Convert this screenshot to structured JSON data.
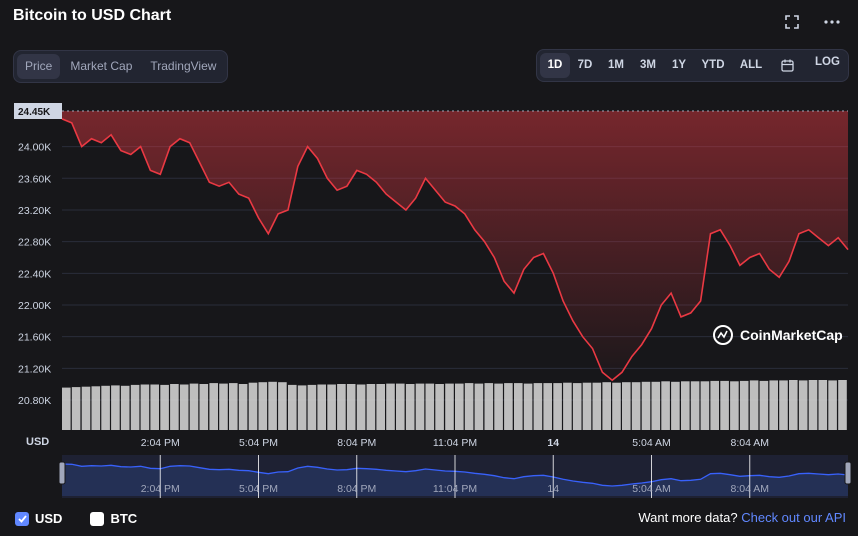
{
  "header": {
    "title": "Bitcoin to USD Chart"
  },
  "tabs": [
    {
      "label": "Price",
      "active": true
    },
    {
      "label": "Market Cap",
      "active": false
    },
    {
      "label": "TradingView",
      "active": false
    }
  ],
  "ranges": [
    {
      "label": "1D",
      "active": true
    },
    {
      "label": "7D",
      "active": false
    },
    {
      "label": "1M",
      "active": false
    },
    {
      "label": "3M",
      "active": false
    },
    {
      "label": "1Y",
      "active": false
    },
    {
      "label": "YTD",
      "active": false
    },
    {
      "label": "ALL",
      "active": false
    }
  ],
  "log_label": "LOG",
  "icons": {
    "expand": "expand-icon",
    "more": "more-icon",
    "calendar": "calendar-icon"
  },
  "colors": {
    "price_line": "#ea3943",
    "volume_bar": "#dcdcdc",
    "navigator_line": "#3861fb",
    "accent_link": "#6188ff"
  },
  "watermark": "CoinMarketCap",
  "legend": [
    {
      "label": "USD",
      "checked": true
    },
    {
      "label": "BTC",
      "checked": false
    }
  ],
  "footer": {
    "text": "Want more data?",
    "link": "Check out our API"
  },
  "chart_data": {
    "type": "line",
    "ylabel": "USD",
    "ylim": [
      20800,
      24450
    ],
    "y_ticks": [
      "24.00K",
      "23.60K",
      "23.20K",
      "22.80K",
      "22.40K",
      "22.00K",
      "21.60K",
      "21.20K",
      "20.80K"
    ],
    "y_tick_values": [
      24000,
      23600,
      23200,
      22800,
      22400,
      22000,
      21600,
      21200,
      20800
    ],
    "current_price_label": "24.45K",
    "current_price_value": 24450,
    "x_ticks": [
      "2:04 PM",
      "5:04 PM",
      "8:04 PM",
      "11:04 PM",
      "14",
      "5:04 AM",
      "8:04 AM"
    ],
    "x_tick_hours": [
      3,
      6,
      9,
      12,
      15,
      18,
      21
    ],
    "xlim_hours": [
      0,
      24
    ],
    "series": [
      {
        "x": [
          0,
          0.3,
          0.6,
          0.9,
          1.2,
          1.5,
          1.8,
          2.1,
          2.4,
          2.7,
          3.0,
          3.3,
          3.6,
          3.9,
          4.2,
          4.5,
          4.8,
          5.1,
          5.4,
          5.7,
          6.0,
          6.3,
          6.6,
          6.9,
          7.2,
          7.5,
          7.8,
          8.1,
          8.4,
          8.7,
          9.0,
          9.3,
          9.6,
          9.9,
          10.2,
          10.5,
          10.8,
          11.1,
          11.4,
          11.7,
          12.0,
          12.3,
          12.6,
          12.9,
          13.2,
          13.5,
          13.8,
          14.1,
          14.4,
          14.7,
          15.0,
          15.3,
          15.6,
          15.9,
          16.2,
          16.5,
          16.8,
          17.1,
          17.4,
          17.7,
          18.0,
          18.3,
          18.6,
          18.9,
          19.2,
          19.5,
          19.8,
          20.1,
          20.4,
          20.7,
          21.0,
          21.3,
          21.6,
          21.9,
          22.2,
          22.5,
          22.8,
          23.1,
          23.4,
          23.7,
          24.0
        ],
        "values": [
          24350,
          24300,
          24000,
          24100,
          24050,
          24150,
          23950,
          23900,
          24000,
          23700,
          23650,
          24000,
          24100,
          24050,
          23800,
          23550,
          23500,
          23550,
          23400,
          23350,
          23100,
          22900,
          23150,
          23200,
          23750,
          24000,
          23850,
          23600,
          23450,
          23500,
          23700,
          23650,
          23550,
          23400,
          23300,
          23200,
          23350,
          23600,
          23450,
          23300,
          23250,
          23150,
          22950,
          22800,
          22600,
          22300,
          22150,
          22450,
          22600,
          22650,
          22400,
          22050,
          21800,
          21600,
          21450,
          21150,
          21050,
          21150,
          21350,
          21500,
          21700,
          22000,
          22150,
          21850,
          21900,
          22050,
          22900,
          22950,
          22750,
          22500,
          22600,
          22650,
          22450,
          22350,
          22550,
          22900,
          22950,
          22850,
          22750,
          22850,
          22700
        ]
      }
    ],
    "volume_relative": [
      0.95,
      0.96,
      0.97,
      0.98,
      0.99,
      1.0,
      0.99,
      1.01,
      1.02,
      1.02,
      1.01,
      1.03,
      1.02,
      1.04,
      1.03,
      1.05,
      1.04,
      1.05,
      1.03,
      1.06,
      1.07,
      1.08,
      1.07,
      1.01,
      1.0,
      1.01,
      1.02,
      1.02,
      1.03,
      1.03,
      1.02,
      1.03,
      1.03,
      1.04,
      1.04,
      1.03,
      1.04,
      1.04,
      1.03,
      1.04,
      1.04,
      1.05,
      1.04,
      1.05,
      1.04,
      1.05,
      1.05,
      1.04,
      1.05,
      1.05,
      1.05,
      1.06,
      1.05,
      1.06,
      1.06,
      1.07,
      1.06,
      1.07,
      1.07,
      1.08,
      1.08,
      1.09,
      1.08,
      1.09,
      1.09,
      1.09,
      1.1,
      1.1,
      1.09,
      1.1,
      1.11,
      1.1,
      1.11,
      1.11,
      1.12,
      1.11,
      1.12,
      1.12,
      1.11,
      1.12
    ],
    "navigator_x_ticks": [
      "2:04 PM",
      "5:04 PM",
      "8:04 PM",
      "11:04 PM",
      "14",
      "5:04 AM",
      "8:04 AM"
    ]
  }
}
